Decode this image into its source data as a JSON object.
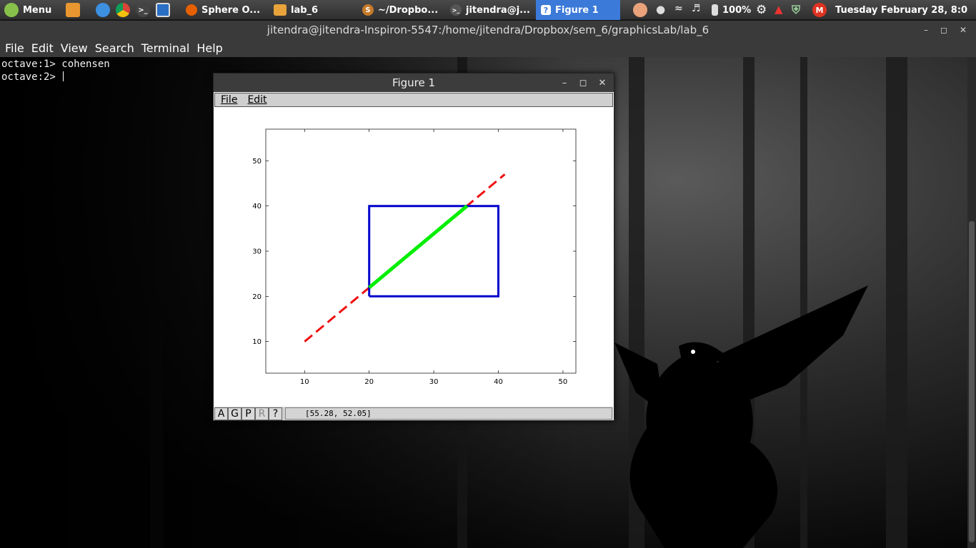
{
  "panel": {
    "menu_label": "Menu",
    "tasks": [
      {
        "label": "Sphere O..."
      },
      {
        "label": "lab_6"
      },
      {
        "label": "~/Dropbo..."
      },
      {
        "label": "jitendra@j..."
      },
      {
        "label": "Figure 1"
      }
    ],
    "battery": "100%",
    "clock": "Tuesday February 28,  8:0"
  },
  "terminal": {
    "title": "jitendra@jitendra-Inspiron-5547:/home/jitendra/Dropbox/sem_6/graphicsLab/lab_6",
    "menu": [
      "File",
      "Edit",
      "View",
      "Search",
      "Terminal",
      "Help"
    ],
    "lines": [
      "octave:1> cohensen",
      "octave:2> "
    ]
  },
  "figure": {
    "title": "Figure 1",
    "menu": [
      "File",
      "Edit"
    ],
    "toolbar": [
      "A",
      "G",
      "P",
      "R",
      "?"
    ],
    "coords": "[55.28, 52.05]"
  },
  "colors": {
    "clip_rect": "#0000cc",
    "inside_segment": "#00ee00",
    "outside_segment": "#ee1111",
    "task_active": "#3b7ad8"
  },
  "chart_data": {
    "type": "line",
    "xlim": [
      4,
      52
    ],
    "ylim": [
      3,
      57
    ],
    "xticks": [
      10,
      20,
      30,
      40,
      50
    ],
    "yticks": [
      10,
      20,
      30,
      40,
      50
    ],
    "grid": false,
    "series": [
      {
        "style": "dashed",
        "color": "red",
        "x": [
          10,
          41
        ],
        "y": [
          10,
          47
        ]
      },
      {
        "style": "solid",
        "color": "blue",
        "x": [
          20,
          40,
          40,
          20,
          20
        ],
        "y": [
          20,
          20,
          40,
          40,
          20
        ]
      },
      {
        "style": "solid",
        "color": "green",
        "x": [
          20,
          35.14
        ],
        "y": [
          21.94,
          40
        ]
      }
    ]
  }
}
